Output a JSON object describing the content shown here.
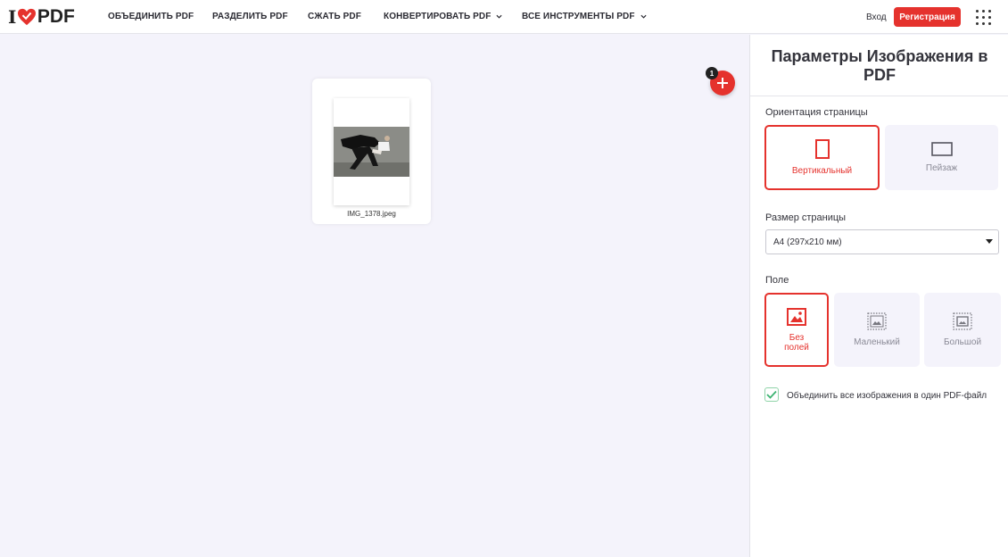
{
  "header": {
    "logo_left": "I",
    "logo_right": "PDF",
    "nav": [
      {
        "label": "ОБЪЕДИНИТЬ PDF"
      },
      {
        "label": "РАЗДЕЛИТЬ PDF"
      },
      {
        "label": "СЖАТЬ PDF"
      },
      {
        "label": "КОНВЕРТИРОВАТЬ PDF"
      },
      {
        "label": "ВСЕ ИНСТРУМЕНТЫ PDF"
      }
    ],
    "login": "Вход",
    "register": "Регистрация"
  },
  "workspace": {
    "file_name": "IMG_1378.jpeg",
    "file_count": "1"
  },
  "sidebar": {
    "title": "Параметры Изображения в PDF",
    "orientation": {
      "label": "Ориентация страницы",
      "options": [
        {
          "label": "Вертикальный",
          "selected": true
        },
        {
          "label": "Пейзаж",
          "selected": false
        }
      ]
    },
    "page_size": {
      "label": "Размер страницы",
      "value": "A4 (297x210 мм)"
    },
    "margin": {
      "label": "Поле",
      "options": [
        {
          "label_line1": "Без",
          "label_line2": "полей",
          "selected": true
        },
        {
          "label": "Маленький",
          "selected": false
        },
        {
          "label": "Большой",
          "selected": false
        }
      ]
    },
    "merge": {
      "checked": true,
      "label": "Объединить все изображения в один PDF-файл"
    }
  },
  "colors": {
    "accent": "#e5322d",
    "background": "#f4f3fb",
    "check": "#3cb371"
  }
}
